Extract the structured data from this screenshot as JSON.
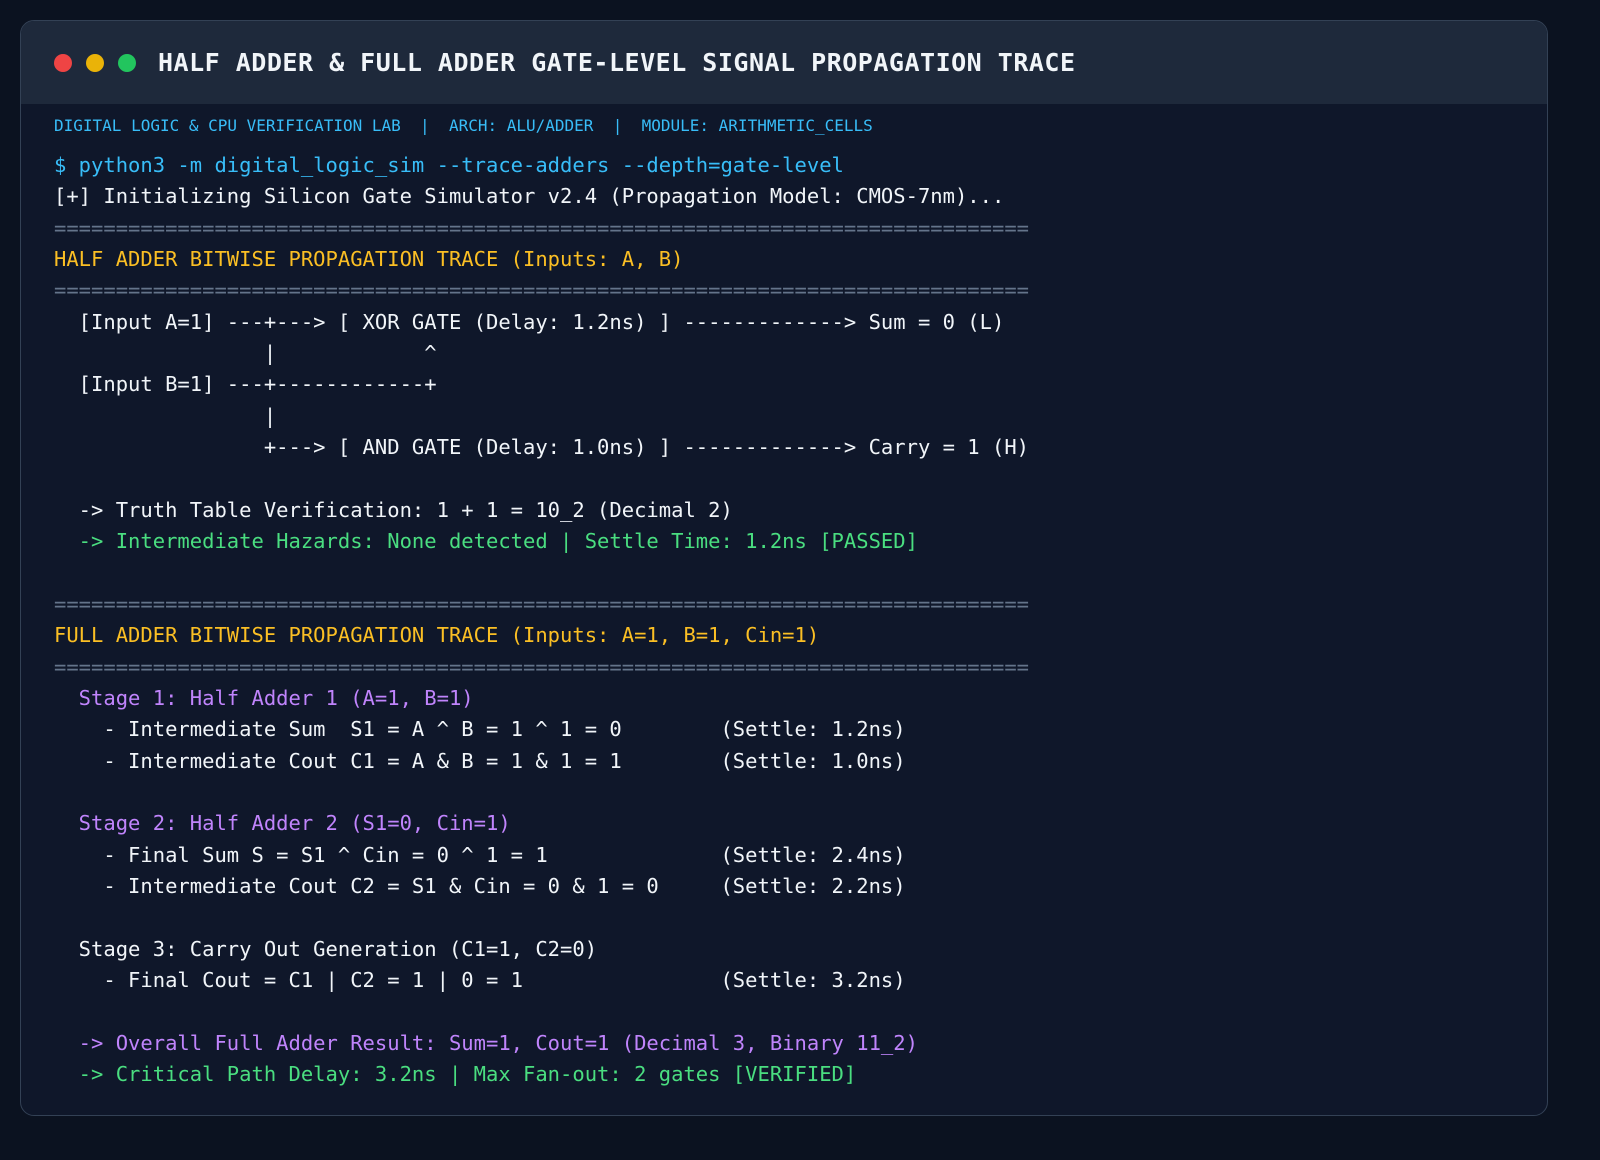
{
  "window": {
    "title": "HALF ADDER & FULL ADDER GATE-LEVEL SIGNAL PROPAGATION TRACE",
    "subheader": "DIGITAL LOGIC & CPU VERIFICATION LAB  |  ARCH: ALU/ADDER  |  MODULE: ARITHMETIC_CELLS"
  },
  "colors": {
    "background": "#0b1220",
    "panel": "#0f172a",
    "titlebar": "#1e293b",
    "command": "#38bdf8",
    "heading": "#fbbf24",
    "success": "#4ade80",
    "stage": "#c084fc",
    "separator": "#64748b",
    "text": "#f1f5f9",
    "dot_close": "#ef4444",
    "dot_minimize": "#eab308",
    "dot_maximize": "#22c55e"
  },
  "terminal": {
    "lines": [
      "$ python3 -m digital_logic_sim --trace-adders --depth=gate-level",
      "[+] Initializing Silicon Gate Simulator v2.4 (Propagation Model: CMOS-7nm)...",
      "===============================================================================",
      "HALF ADDER BITWISE PROPAGATION TRACE (Inputs: A, B)",
      "===============================================================================",
      "  [Input A=1] ---+---> [ XOR GATE (Delay: 1.2ns) ] -------------> Sum = 0 (L)",
      "                 |            ^",
      "  [Input B=1] ---+------------+",
      "                 |",
      "                 +---> [ AND GATE (Delay: 1.0ns) ] -------------> Carry = 1 (H)",
      "",
      "  -> Truth Table Verification: 1 + 1 = 10_2 (Decimal 2)",
      "  -> Intermediate Hazards: None detected | Settle Time: 1.2ns [PASSED]",
      "",
      "===============================================================================",
      "FULL ADDER BITWISE PROPAGATION TRACE (Inputs: A=1, B=1, Cin=1)",
      "===============================================================================",
      "  Stage 1: Half Adder 1 (A=1, B=1)",
      "    - Intermediate Sum  S1 = A ^ B = 1 ^ 1 = 0        (Settle: 1.2ns)",
      "    - Intermediate Cout C1 = A & B = 1 & 1 = 1        (Settle: 1.0ns)",
      "",
      "  Stage 2: Half Adder 2 (S1=0, Cin=1)",
      "    - Final Sum S = S1 ^ Cin = 0 ^ 1 = 1              (Settle: 2.4ns)",
      "    - Intermediate Cout C2 = S1 & Cin = 0 & 1 = 0     (Settle: 2.2ns)",
      "",
      "  Stage 3: Carry Out Generation (C1=1, C2=0)",
      "    - Final Cout = C1 | C2 = 1 | 0 = 1                (Settle: 3.2ns)",
      "",
      "  -> Overall Full Adder Result: Sum=1, Cout=1 (Decimal 3, Binary 11_2)",
      "  -> Critical Path Delay: 3.2ns | Max Fan-out: 2 gates [VERIFIED]"
    ]
  }
}
